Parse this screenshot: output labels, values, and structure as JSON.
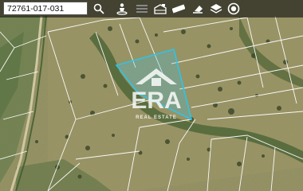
{
  "search": {
    "value": "72761-017-031"
  },
  "toolbar": {
    "tools": [
      {
        "icon": "search-icon"
      },
      {
        "icon": "person-pin-icon"
      },
      {
        "icon": "layers-icon"
      },
      {
        "icon": "building-icon"
      },
      {
        "icon": "ruler-icon"
      },
      {
        "icon": "erase-icon"
      },
      {
        "icon": "map-layers-icon"
      },
      {
        "icon": "record-icon"
      }
    ]
  },
  "watermark": {
    "brand": "ERA",
    "tagline": "REAL ESTATE"
  },
  "colors": {
    "parcel_outline": "#2fc4e6",
    "parcel_fill": "rgba(60, 190, 230, 0.28)",
    "boundary_lines": "#ffffff",
    "toolbar_bg": "rgba(20,20,20,0.62)"
  }
}
